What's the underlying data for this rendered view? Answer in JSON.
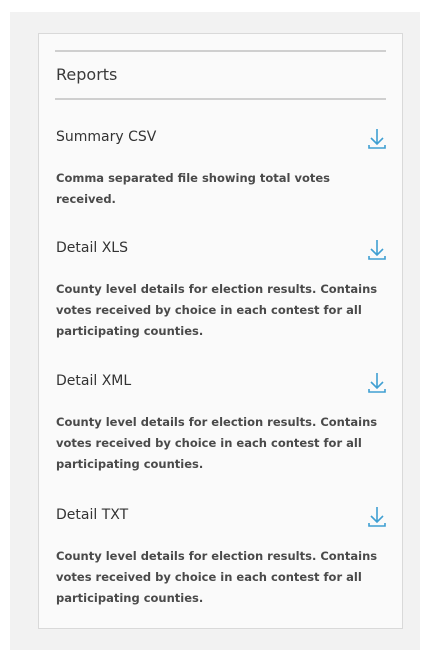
{
  "panel": {
    "title": "Reports"
  },
  "reports": [
    {
      "name": "Summary CSV",
      "description": "Comma separated file showing total votes received.",
      "icon": "download-icon"
    },
    {
      "name": "Detail XLS",
      "description": "County level details for election results. Contains votes received by choice in each contest for all participating counties.",
      "icon": "download-icon"
    },
    {
      "name": "Detail XML",
      "description": "County level details for election results. Contains votes received by choice in each contest for all participating counties.",
      "icon": "download-icon"
    },
    {
      "name": "Detail TXT",
      "description": "County level details for election results. Contains votes received by choice in each contest for all participating counties.",
      "icon": "download-icon"
    }
  ],
  "colors": {
    "icon_accent": "#3f9fd2",
    "panel_bg": "#fafafa",
    "page_bg": "#f2f2f2"
  }
}
